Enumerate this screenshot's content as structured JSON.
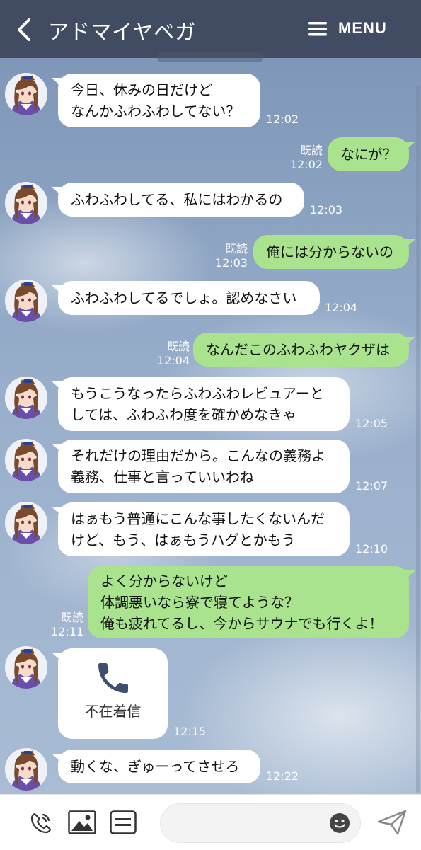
{
  "header": {
    "title": "アドマイヤベガ",
    "menu_label": "MENU"
  },
  "messages": [
    {
      "side": "in",
      "lines": [
        "今日、休みの日だけど",
        "なんかふわふわしてない？"
      ],
      "time": "12:02"
    },
    {
      "side": "out",
      "lines": [
        "なにが？"
      ],
      "read": "既読",
      "time": "12:02"
    },
    {
      "side": "in",
      "lines": [
        "ふわふわしてる、私にはわかるの"
      ],
      "time": "12:03"
    },
    {
      "side": "out",
      "lines": [
        "俺には分からないの"
      ],
      "read": "既読",
      "time": "12:03"
    },
    {
      "side": "in",
      "lines": [
        "ふわふわしてるでしょ。認めなさい"
      ],
      "time": "12:04"
    },
    {
      "side": "out",
      "lines": [
        "なんだこのふわふわヤクザは"
      ],
      "read": "既読",
      "time": "12:04"
    },
    {
      "side": "in",
      "lines": [
        "もうこうなったらふわふわレビュアーと",
        "しては、ふわふわ度を確かめなきゃ"
      ],
      "time": "12:05"
    },
    {
      "side": "in",
      "lines": [
        "それだけの理由だから。こんなの義務よ",
        "義務、仕事と言っていいわね"
      ],
      "time": "12:07"
    },
    {
      "side": "in",
      "lines": [
        "はぁもう普通にこんな事したくないんだ",
        "けど、もう、はぁもうハグとかもう"
      ],
      "time": "12:10"
    },
    {
      "side": "out",
      "lines": [
        "よく分からないけど",
        "体調悪いなら寮で寝てような？",
        "俺も疲れてるし、今からサウナでも行くよ！"
      ],
      "read": "既読",
      "time": "12:11"
    },
    {
      "side": "in",
      "type": "call",
      "call_label": "不在着信",
      "icon": "phone-icon",
      "time": "12:15"
    },
    {
      "side": "in",
      "lines": [
        "動くな、ぎゅーってさせろ"
      ],
      "time": "12:22"
    }
  ],
  "input_bar": {
    "icons": [
      "call-icon",
      "image-icon",
      "message-icon",
      "emoji-icon",
      "send-icon"
    ]
  },
  "colors": {
    "header": "#414b62",
    "outgoing_bubble": "#a9e38d",
    "incoming_bubble": "#ffffff"
  }
}
